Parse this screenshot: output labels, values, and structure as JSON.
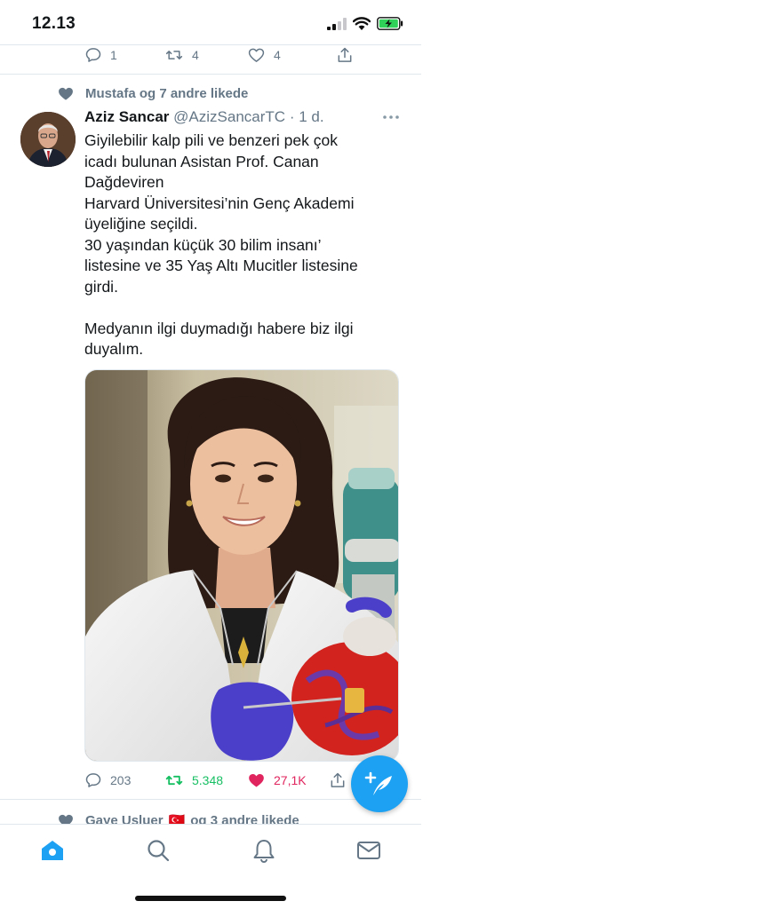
{
  "status_bar": {
    "time": "12.13"
  },
  "prev_tweet_actions": {
    "replies": "1",
    "retweets": "4",
    "likes": "4"
  },
  "liked_by": {
    "text": "Mustafa og 7 andre likede"
  },
  "tweet": {
    "author_name": "Aziz Sancar",
    "author_handle": "@AzizSancarTC",
    "time": "· 1 d.",
    "text_lines": [
      "Giyilebilir kalp pili ve benzeri pek çok",
      "icadı bulunan Asistan Prof. Canan",
      "Dağdeviren",
      "Harvard Üniversitesi’nin Genç Akademi",
      "üyeliğine seçildi.",
      "30 yaşından küçük 30 bilim insanı’",
      "listesine ve 35 Yaş Altı Mucitler listesine",
      "girdi.",
      "Medyanın ilgi duymadığı habere biz ilgi",
      "duyalım."
    ],
    "replies": "203",
    "retweets": "5.348",
    "likes": "27,1K"
  },
  "next_liked_by": {
    "text": "Gaye Usluer",
    "flag": "🇹🇷",
    "text_suffix": "og 3 andre likede"
  },
  "colors": {
    "twitter_blue": "#1da1f2",
    "grey": "#657786",
    "green": "#17bf63",
    "like_red": "#e0245e"
  },
  "icons": {
    "reply": "comment-bubble-icon",
    "retweet": "retweet-icon",
    "like": "heart-icon",
    "share": "share-icon",
    "more": "more-dots-icon",
    "compose": "compose-feather-icon",
    "home": "home-icon",
    "search": "search-icon",
    "notifications": "bell-icon",
    "messages": "mail-icon"
  }
}
